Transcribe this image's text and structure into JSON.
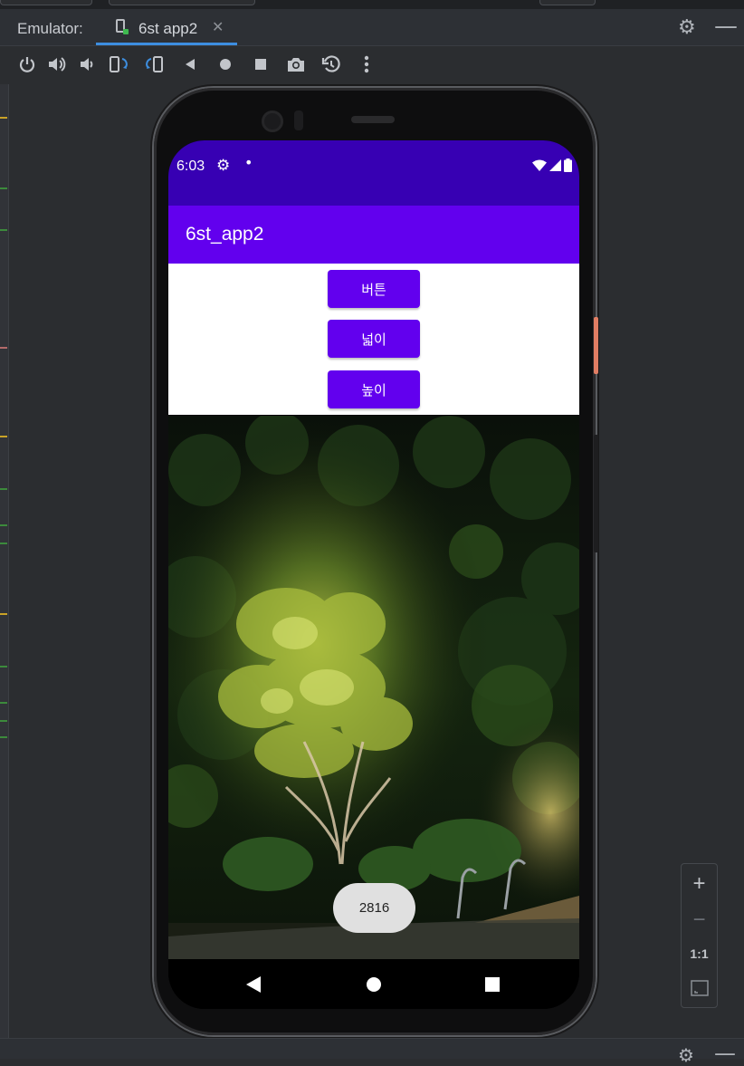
{
  "tool_window": {
    "title": "Emulator:",
    "tab_label": "6st app2",
    "tab_close": "✕",
    "settings_icon": "gear-icon",
    "hide_icon": "minus-icon"
  },
  "toolbar": {
    "items": [
      "power-icon",
      "volume-up-icon",
      "volume-down-icon",
      "rotate-left-icon",
      "rotate-right-icon",
      "back-icon",
      "home-icon",
      "overview-icon",
      "screenshot-icon",
      "snapshot-icon",
      "more-icon"
    ]
  },
  "device": {
    "status": {
      "time": "6:03",
      "settings_icon": "gear-icon",
      "dot": "•"
    },
    "app_title": "6st_app2",
    "buttons": {
      "button": "버튼",
      "width": "넓이",
      "height": "높이"
    },
    "toast": "2816"
  },
  "zoom": {
    "zoom_in": "+",
    "zoom_out": "−",
    "actual_size": "1:1"
  },
  "colors": {
    "status_bar": "#3700b3",
    "app_bar": "#6200ee",
    "button": "#6200ee",
    "tab_underline": "#3d8ee0"
  }
}
